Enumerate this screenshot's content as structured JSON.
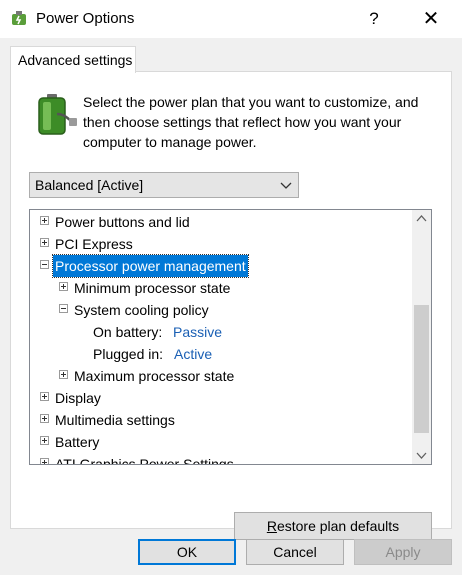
{
  "window": {
    "title": "Power Options",
    "help_glyph": "?",
    "close_glyph": "✕",
    "icon": "power-options-icon"
  },
  "tab": {
    "label": "Advanced settings"
  },
  "intro": {
    "icon": "battery-plug-icon",
    "text": "Select the power plan that you want to customize, and then choose settings that reflect how you want your computer to manage power."
  },
  "plan_select": {
    "value": "Balanced [Active]"
  },
  "tree": {
    "items": [
      {
        "label": "Power buttons and lid"
      },
      {
        "label": "PCI Express"
      },
      {
        "label": "Processor power management"
      },
      {
        "label": "Minimum processor state"
      },
      {
        "label": "System cooling policy"
      },
      {
        "label": "On battery:",
        "value": "Passive"
      },
      {
        "label": "Plugged in:",
        "value": "Active"
      },
      {
        "label": "Maximum processor state"
      },
      {
        "label": "Display"
      },
      {
        "label": "Multimedia settings"
      },
      {
        "label": "Battery"
      },
      {
        "label": "ATI Graphics Power Settings"
      }
    ]
  },
  "buttons": {
    "restore_underline": "R",
    "restore_rest": "estore plan defaults",
    "ok": "OK",
    "cancel": "Cancel",
    "apply": "Apply"
  },
  "colors": {
    "selection": "#0078d7",
    "link": "#1a5fb4",
    "client_bg": "#f0f0f0"
  }
}
